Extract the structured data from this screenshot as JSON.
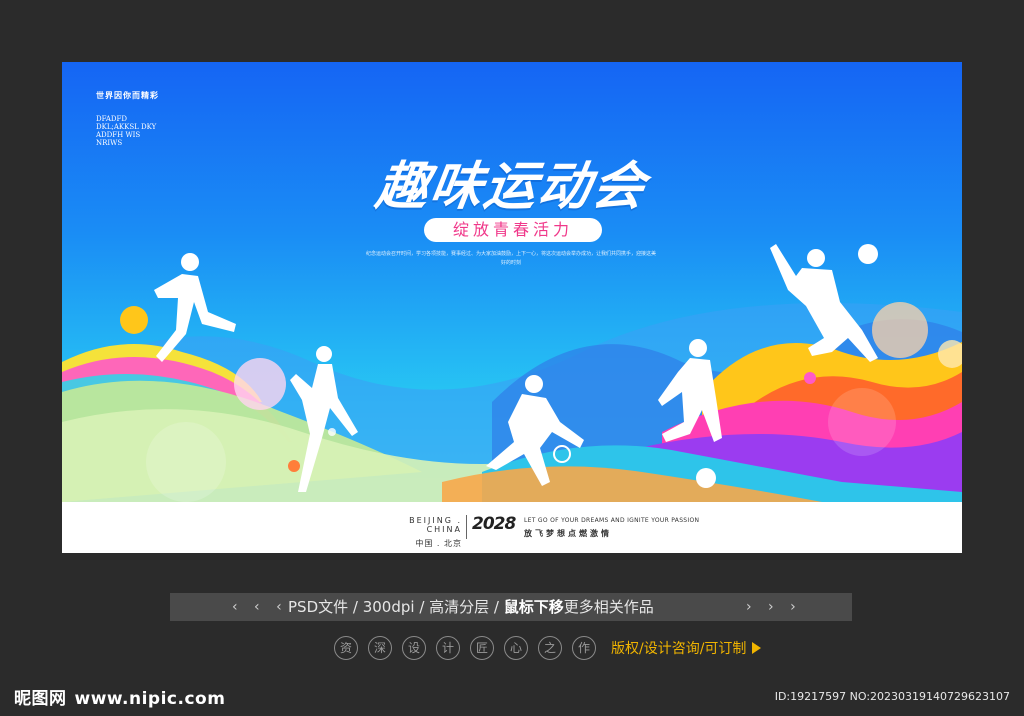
{
  "poster": {
    "corner_title": "世界因你而精彩",
    "corner_lines": [
      "DFADFD",
      "DKL;AKKSL DKY",
      "ADDFH WIS",
      "NRIWS"
    ],
    "title": "趣味运动会",
    "subtitle": "绽放青春活力",
    "description": "纪念运动会召开时间，学习各项技能，赛事经过、为大家加油鼓励，上下一心，将这次运动会举办成功，让我们共同携手，迎接这美好的时刻",
    "footer": {
      "city_en": "BEIJING . CHINA",
      "city_cn": "中国 . 北京",
      "year": "2028",
      "slogan_en": "LET GO OF YOUR DREAMS AND IGNITE YOUR PASSION",
      "slogan_cn": "放飞梦想点燃激情"
    }
  },
  "info_bar": {
    "chevrons_left": "‹ ‹ ‹",
    "chevrons_right": "› › ›",
    "text_a": "PSD文件 /  300dpi /  高清分层  /  ",
    "text_bold": "鼠标下移",
    "text_b": "更多相关作品"
  },
  "circles": [
    "资",
    "深",
    "设",
    "计",
    "匠",
    "心",
    "之",
    "作"
  ],
  "copyright_link": "版权/设计咨询/可订制",
  "brand": {
    "name": "昵图网",
    "url": "www.nipic.com"
  },
  "id_text": "ID:19217597 NO:20230319140729623107",
  "colors": {
    "background": "#2b2b2b",
    "accent": "#f0b400",
    "title_pink": "#f0388a"
  }
}
